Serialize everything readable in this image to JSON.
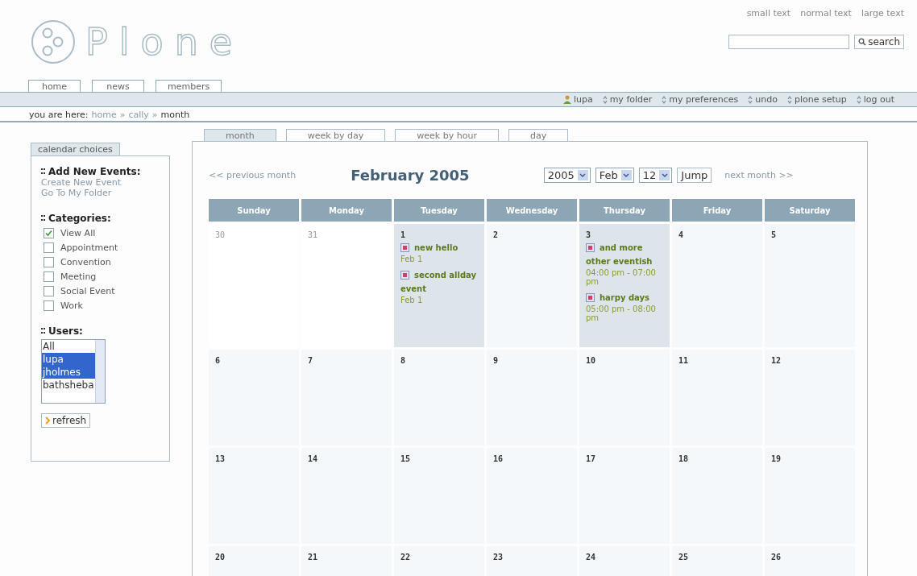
{
  "logo": {
    "text": "Plone"
  },
  "text_size_links": [
    "small text",
    "normal text",
    "large text"
  ],
  "search": {
    "button": "search"
  },
  "site_tabs": [
    {
      "label": "home",
      "selected": false
    },
    {
      "label": "news",
      "selected": false
    },
    {
      "label": "members",
      "selected": false
    }
  ],
  "personal_bar": [
    {
      "label": "lupa",
      "kind": "user"
    },
    {
      "label": "my folder",
      "kind": "link"
    },
    {
      "label": "my preferences",
      "kind": "link"
    },
    {
      "label": "undo",
      "kind": "link"
    },
    {
      "label": "plone setup",
      "kind": "link"
    },
    {
      "label": "log out",
      "kind": "link"
    }
  ],
  "breadcrumb": {
    "label": "you are here:",
    "separator": "»",
    "items": [
      "home",
      "cally",
      "month"
    ]
  },
  "sidebar": {
    "title": "calendar choices",
    "add_events": {
      "heading": "Add New Events:",
      "links": [
        "Create New Event",
        "Go To My Folder"
      ]
    },
    "categories": {
      "heading": "Categories:",
      "items": [
        {
          "label": "View All",
          "checked": true
        },
        {
          "label": "Appointment",
          "checked": false
        },
        {
          "label": "Convention",
          "checked": false
        },
        {
          "label": "Meeting",
          "checked": false
        },
        {
          "label": "Social Event",
          "checked": false
        },
        {
          "label": "Work",
          "checked": false
        }
      ]
    },
    "users": {
      "heading": "Users:",
      "options": [
        {
          "label": "All",
          "selected": false
        },
        {
          "label": "lupa",
          "selected": true
        },
        {
          "label": "jholmes",
          "selected": true
        },
        {
          "label": "bathsheba",
          "selected": false
        }
      ]
    },
    "refresh_button": "refresh"
  },
  "view_tabs": [
    {
      "label": "month",
      "selected": true
    },
    {
      "label": "week by day",
      "selected": false
    },
    {
      "label": "week by hour",
      "selected": false
    },
    {
      "label": "day",
      "selected": false
    }
  ],
  "nav": {
    "previous": "<< previous month",
    "title": "February 2005",
    "year": "2005",
    "month": "Feb",
    "day": "12",
    "jump": "Jump",
    "next": "next month >>"
  },
  "calendar": {
    "weekdays": [
      "Sunday",
      "Monday",
      "Tuesday",
      "Wednesday",
      "Thursday",
      "Friday",
      "Saturday"
    ],
    "weeks": [
      [
        {
          "day": "30",
          "other_month": true
        },
        {
          "day": "31",
          "other_month": true
        },
        {
          "day": "1",
          "other_month": false,
          "events": [
            {
              "title": "new hello",
              "time": "Feb 1"
            },
            {
              "title": "second allday event",
              "time": "Feb 1"
            }
          ]
        },
        {
          "day": "2",
          "other_month": false
        },
        {
          "day": "3",
          "other_month": false,
          "events": [
            {
              "title": "and more other eventish",
              "time": "04:00 pm - 07:00 pm"
            },
            {
              "title": "harpy days",
              "time": "05:00 pm - 08:00 pm"
            }
          ]
        },
        {
          "day": "4",
          "other_month": false
        },
        {
          "day": "5",
          "other_month": false
        }
      ],
      [
        {
          "day": "6",
          "other_month": false
        },
        {
          "day": "7",
          "other_month": false
        },
        {
          "day": "8",
          "other_month": false
        },
        {
          "day": "9",
          "other_month": false
        },
        {
          "day": "10",
          "other_month": false
        },
        {
          "day": "11",
          "other_month": false
        },
        {
          "day": "12",
          "other_month": false
        }
      ],
      [
        {
          "day": "13",
          "other_month": false
        },
        {
          "day": "14",
          "other_month": false
        },
        {
          "day": "15",
          "other_month": false
        },
        {
          "day": "16",
          "other_month": false
        },
        {
          "day": "17",
          "other_month": false
        },
        {
          "day": "18",
          "other_month": false
        },
        {
          "day": "19",
          "other_month": false
        }
      ],
      [
        {
          "day": "20",
          "other_month": false
        },
        {
          "day": "21",
          "other_month": false
        },
        {
          "day": "22",
          "other_month": false
        },
        {
          "day": "23",
          "other_month": false
        },
        {
          "day": "24",
          "other_month": false
        },
        {
          "day": "25",
          "other_month": false
        },
        {
          "day": "26",
          "other_month": false
        }
      ]
    ]
  }
}
